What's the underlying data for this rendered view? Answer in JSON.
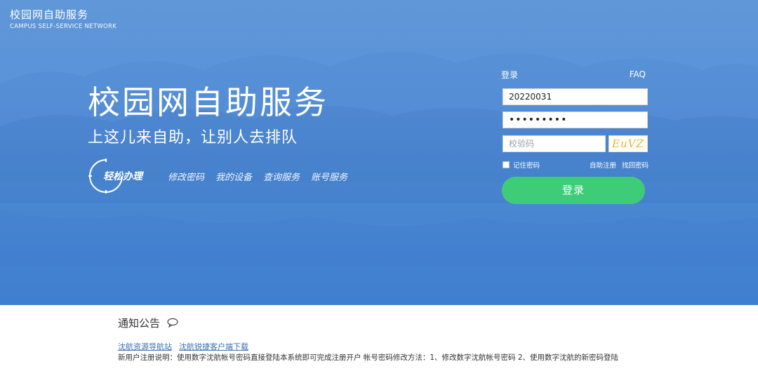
{
  "brand": {
    "title": "校园网自助服务",
    "subtitle": "CAMPUS SELF-SERVICE NETWORK"
  },
  "hero": {
    "headline": "校园网自助服务",
    "slogan": "上这儿来自助，让别人去排队",
    "quick_label": "轻松办理",
    "quick_links": [
      "修改密码",
      "我的设备",
      "查询服务",
      "账号服务"
    ]
  },
  "login": {
    "tab_label": "登录",
    "faq_label": "FAQ",
    "username_value": "20220031",
    "password_mask": "•••••••••",
    "captcha_placeholder": "校验码",
    "captcha_text": "EuVZ",
    "remember_label": "记住密码",
    "register_label": "自助注册",
    "recover_label": "找回密码",
    "submit_label": "登录"
  },
  "notice": {
    "title": "通知公告",
    "links": [
      "沈航资源导航站",
      "沈航锐捷客户端下载"
    ],
    "text": "新用户注册说明：使用数字沈航帐号密码直接登陆本系统即可完成注册开户    帐号密码修改方法：1、修改数字沈航帐号密码 2、使用数字沈航的新密码登陆"
  },
  "colors": {
    "hero_blue": "#4a89d3",
    "button_green": "#3fcc79",
    "link_blue": "#3a6fb5"
  }
}
